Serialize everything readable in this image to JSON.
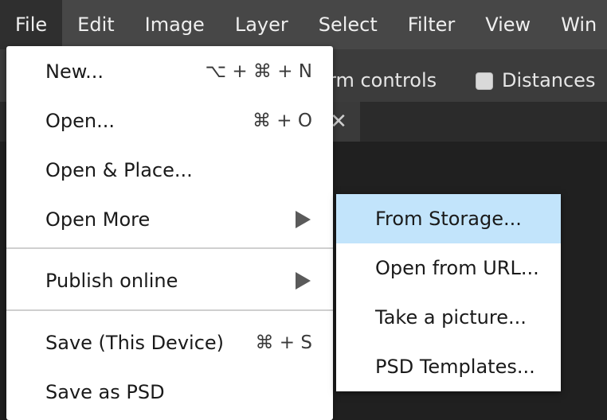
{
  "menubar": {
    "items": [
      {
        "label": "File"
      },
      {
        "label": "Edit"
      },
      {
        "label": "Image"
      },
      {
        "label": "Layer"
      },
      {
        "label": "Select"
      },
      {
        "label": "Filter"
      },
      {
        "label": "View"
      },
      {
        "label": "Win"
      }
    ]
  },
  "options": {
    "transform_controls_label": "rm controls",
    "distances_label": "Distances",
    "distances_checked": false
  },
  "tab": {
    "close_glyph": "✕"
  },
  "file_menu": {
    "items": [
      {
        "label": "New...",
        "shortcut": "⌥ + ⌘ + N"
      },
      {
        "label": "Open...",
        "shortcut": "⌘ + O"
      },
      {
        "label": "Open & Place...",
        "shortcut": ""
      },
      {
        "label": "Open More",
        "shortcut": ""
      },
      {
        "label": "Publish online",
        "shortcut": ""
      },
      {
        "label": "Save (This Device)",
        "shortcut": "⌘ + S"
      },
      {
        "label": "Save as PSD",
        "shortcut": ""
      }
    ]
  },
  "open_more_submenu": {
    "items": [
      {
        "label": "From Storage..."
      },
      {
        "label": "Open from URL..."
      },
      {
        "label": "Take a picture..."
      },
      {
        "label": "PSD Templates..."
      }
    ],
    "highlighted_index": 0,
    "highlight_color": "#c2e4fb"
  }
}
